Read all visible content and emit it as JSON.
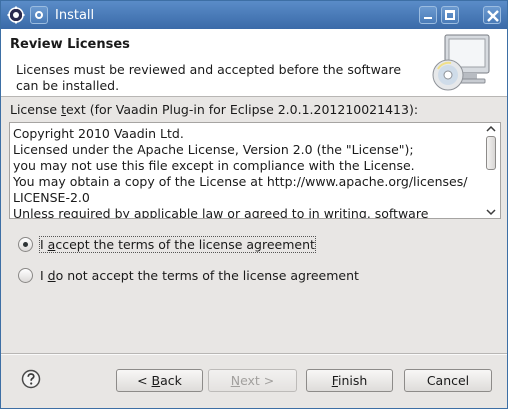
{
  "window": {
    "title": "Install"
  },
  "banner": {
    "heading": "Review Licenses",
    "description": "Licenses must be reviewed and accepted before the software can be installed."
  },
  "license": {
    "label_prefix": "License ",
    "label_mnemonic": "t",
    "label_suffix": "ext (for Vaadin Plug-in for Eclipse 2.0.1.201210021413):",
    "lines": [
      "Copyright 2010 Vaadin Ltd.",
      "Licensed under the Apache License, Version 2.0 (the \"License\");",
      "you may not use this file except in compliance with the License.",
      "You may obtain a copy of the License at http://www.apache.org/licenses/",
      "LICENSE-2.0",
      "Unless required by applicable law or agreed to in writing, software"
    ]
  },
  "options": {
    "accept": {
      "prefix": "I ",
      "mnemonic": "a",
      "suffix": "ccept the terms of the license agreement",
      "selected": true
    },
    "decline": {
      "prefix": "I ",
      "mnemonic": "d",
      "suffix": "o not accept the terms of the license agreement",
      "selected": false
    }
  },
  "buttons": {
    "back": {
      "prefix": "< ",
      "mnemonic": "B",
      "suffix": "ack",
      "enabled": true
    },
    "next": {
      "prefix": "",
      "mnemonic": "N",
      "suffix": "ext >",
      "enabled": false
    },
    "finish": {
      "prefix": "",
      "mnemonic": "F",
      "suffix": "inish",
      "enabled": true
    },
    "cancel": {
      "label": "Cancel",
      "enabled": true
    }
  },
  "icons": {
    "app": "eclipse-gear-icon",
    "menu": "window-menu-icon",
    "minimize": "minimize-icon",
    "maximize": "maximize-icon",
    "close": "close-icon",
    "banner": "cd-monitor-icon",
    "help": "help-icon"
  },
  "colors": {
    "titlebar": "#4a7bb8",
    "window_bg": "#e8e6e4",
    "disabled_text": "#a2a09e"
  }
}
